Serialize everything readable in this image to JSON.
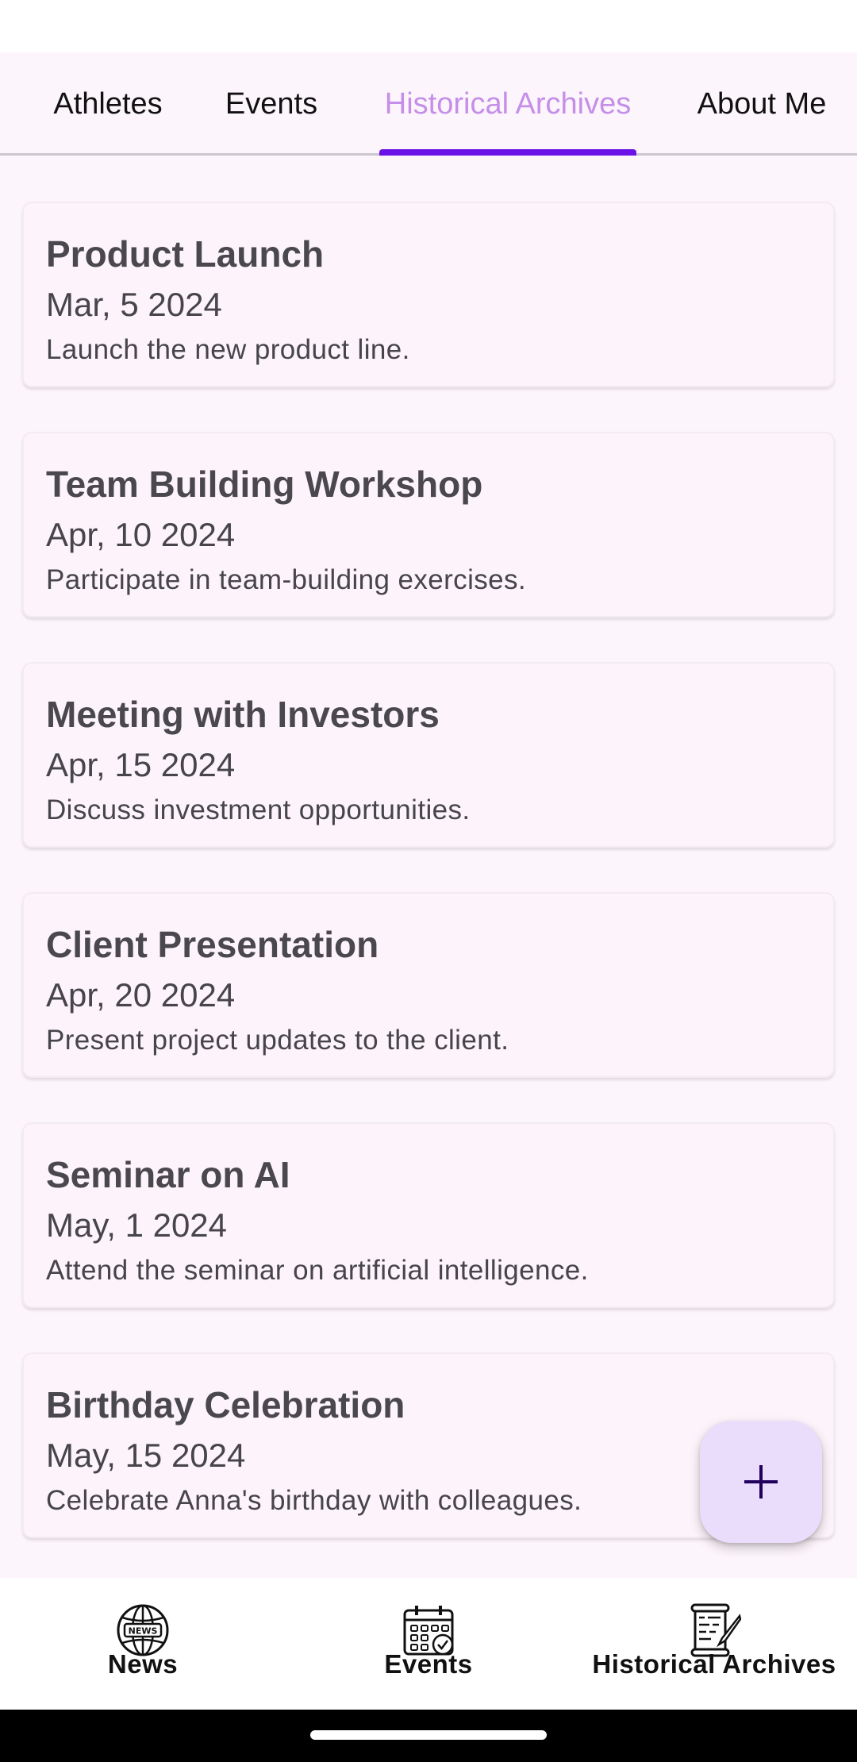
{
  "tabs": [
    {
      "label": "Athletes"
    },
    {
      "label": "Events"
    },
    {
      "label": "Historical Archives",
      "active": true
    },
    {
      "label": "About Me"
    }
  ],
  "events": [
    {
      "title": "Product Launch",
      "date": "Mar, 5 2024",
      "description": "Launch the new product line."
    },
    {
      "title": "Team Building Workshop",
      "date": "Apr, 10 2024",
      "description": "Participate in team-building exercises."
    },
    {
      "title": "Meeting with Investors",
      "date": "Apr, 15 2024",
      "description": "Discuss investment opportunities."
    },
    {
      "title": "Client Presentation",
      "date": "Apr, 20 2024",
      "description": "Present project updates to the client."
    },
    {
      "title": "Seminar on AI",
      "date": "May, 1 2024",
      "description": "Attend the seminar on artificial intelligence."
    },
    {
      "title": "Birthday Celebration",
      "date": "May, 15 2024",
      "description": "Celebrate Anna's birthday with colleagues."
    }
  ],
  "fab": {
    "icon": "plus-icon"
  },
  "bottom_nav": [
    {
      "label": "News",
      "icon": "news-globe-icon"
    },
    {
      "label": "Events",
      "icon": "calendar-check-icon"
    },
    {
      "label": "Historical Archives",
      "icon": "scroll-quill-icon",
      "active": true
    }
  ],
  "colors": {
    "background": "#fcf5fb",
    "active_tab_text": "#c58ee8",
    "tab_indicator": "#6a11e6",
    "fab_background": "#e9ddfb",
    "fab_icon": "#21005d"
  }
}
